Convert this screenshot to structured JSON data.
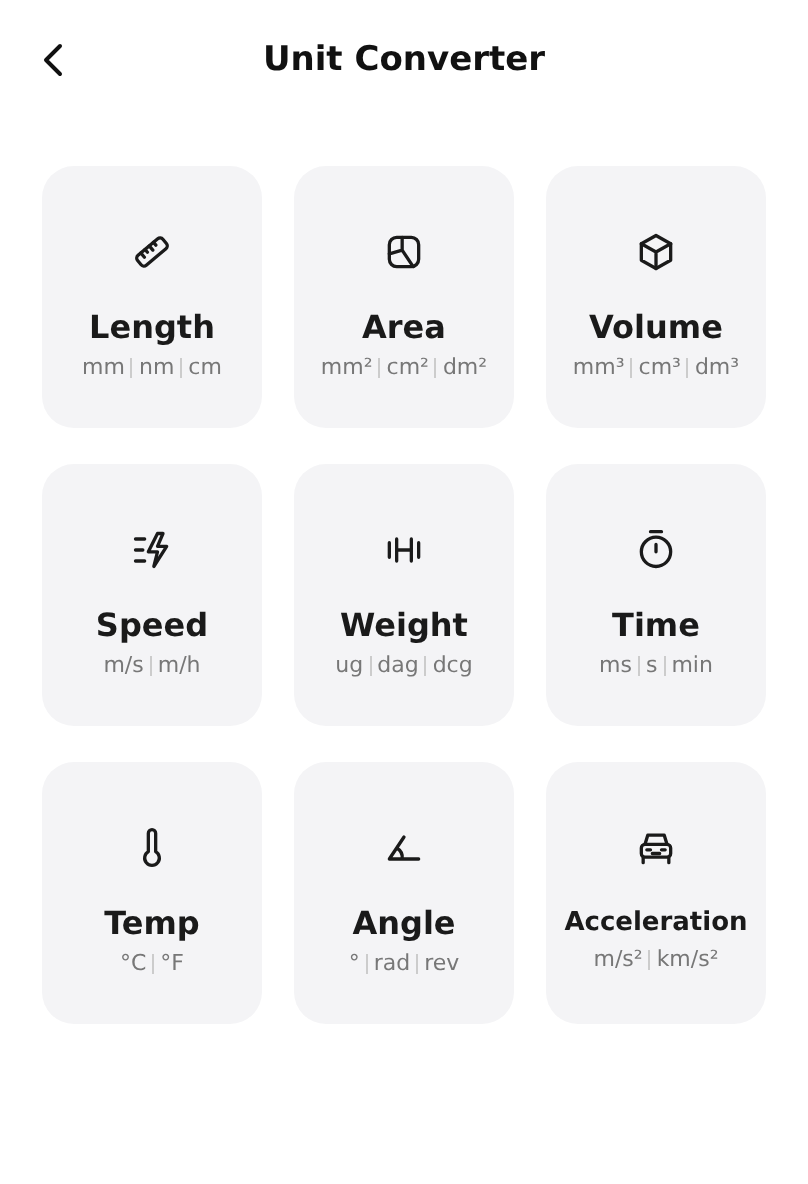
{
  "header": {
    "title": "Unit Converter"
  },
  "categories": [
    {
      "name": "Length",
      "units": [
        "mm",
        "nm",
        "cm"
      ]
    },
    {
      "name": "Area",
      "units": [
        "mm²",
        "cm²",
        "dm²"
      ]
    },
    {
      "name": "Volume",
      "units": [
        "mm³",
        "cm³",
        "dm³"
      ]
    },
    {
      "name": "Speed",
      "units": [
        "m/s",
        "m/h"
      ]
    },
    {
      "name": "Weight",
      "units": [
        "ug",
        "dag",
        "dcg"
      ]
    },
    {
      "name": "Time",
      "units": [
        "ms",
        "s",
        "min"
      ]
    },
    {
      "name": "Temp",
      "units": [
        "°C",
        "°F"
      ]
    },
    {
      "name": "Angle",
      "units": [
        "°",
        "rad",
        "rev"
      ]
    },
    {
      "name": "Acceleration",
      "units": [
        "m/s²",
        "km/s²"
      ]
    }
  ]
}
